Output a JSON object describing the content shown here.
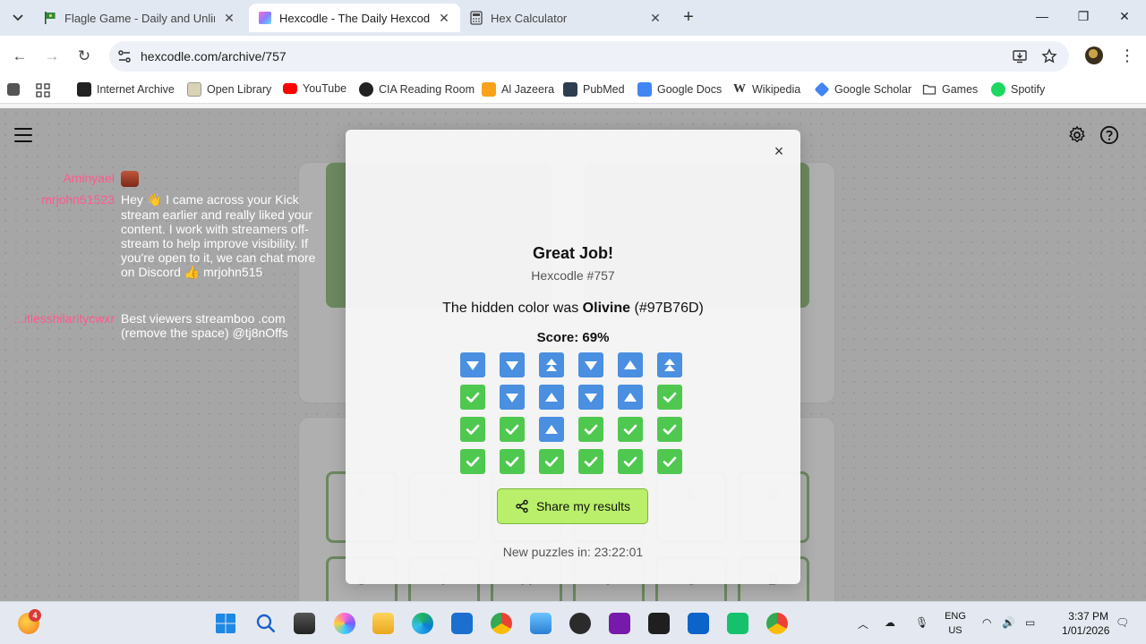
{
  "browser": {
    "tabs": [
      {
        "title": "Flagle Game - Daily and Unlimi",
        "active": false
      },
      {
        "title": "Hexcodle - The Daily Hexcode (",
        "active": true
      },
      {
        "title": "Hex Calculator",
        "active": false
      }
    ],
    "url": "hexcodle.com/archive/757",
    "bookmarks": [
      "Internet Archive",
      "Open Library",
      "YouTube",
      "CIA Reading Room",
      "Al Jazeera",
      "PubMed",
      "Google Docs",
      "Wikipedia",
      "Google Scholar",
      "Games",
      "Spotify"
    ]
  },
  "page": {
    "background_header": "Hexcodle #757",
    "bg_grid_row1": [
      "9",
      "7",
      "B",
      "7",
      "6",
      "D"
    ],
    "bg_grid_row2": [
      "9",
      "7",
      "A",
      "7",
      "6",
      "D"
    ]
  },
  "chat": [
    {
      "user": "Aminyael",
      "message": ""
    },
    {
      "user": "mrjohn51523",
      "message": "Hey 👋 I came across your Kick stream earlier and really liked your content. I work with streamers off-stream to help improve visibility. If you're open to it, we can chat more on Discord 👍 mrjohn515"
    },
    {
      "user": "itlesshilaritycwxr...",
      "message": "Best viewers streamboo .com (remove the space) @tj8nOffs"
    }
  ],
  "modal": {
    "title": "Great Job!",
    "subtitle": "Hexcodle #757",
    "hidden_prefix": "The hidden color was ",
    "color_name": "Olivine",
    "color_hex": "(#97B76D)",
    "score_label": "Score: 69%",
    "results": [
      [
        "down",
        "down",
        "upup",
        "down",
        "up",
        "upup"
      ],
      [
        "correct",
        "down",
        "up",
        "down",
        "up",
        "correct"
      ],
      [
        "correct",
        "correct",
        "up",
        "correct",
        "correct",
        "correct"
      ],
      [
        "correct",
        "correct",
        "correct",
        "correct",
        "correct",
        "correct"
      ]
    ],
    "share_label": "Share my results",
    "timer_label": "New puzzles in: 23:22:01",
    "close_label": "×"
  },
  "taskbar": {
    "badge_count": "4",
    "lang_line1": "ENG",
    "lang_line2": "US",
    "time": "3:37 PM",
    "date": "1/01/2026"
  },
  "colors": {
    "correct": "#4fc84f",
    "direction": "#4a8fe0",
    "share_button": "#b9ef6a",
    "chat_username": "#ff5a8c",
    "target_color": "#97B76D"
  }
}
